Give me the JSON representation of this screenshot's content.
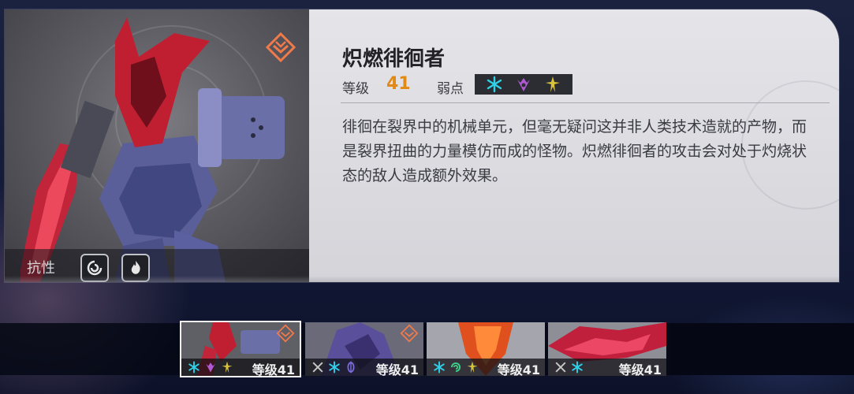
{
  "enemy": {
    "name": "炽燃徘徊者",
    "level_label": "等级",
    "level_value": "41",
    "weakness_label": "弱点",
    "weaknesses": [
      "ice-icon",
      "void-icon",
      "lightning-icon"
    ],
    "resistance_label": "抗性",
    "resistances": [
      "wind-resist-icon",
      "fire-resist-icon"
    ],
    "description": "徘徊在裂界中的机械单元，但毫无疑问这并非人类技术造就的产物，而是裂界扭曲的力量模仿而成的怪物。炽燃徘徊者的攻击会对处于灼烧状态的敌人造成额外效果。"
  },
  "colors": {
    "level_accent": "#e28a18",
    "ice": "#2fd0e8",
    "void": "#b25ad6",
    "lightning": "#d9c33a",
    "physical": "#c8c8c8",
    "imaginary": "#7a6de0",
    "wind": "#3fce8a"
  },
  "enemy_list": [
    {
      "label": "等级41",
      "weaknesses": [
        "ice-icon",
        "void-icon",
        "lightning-icon"
      ],
      "elite": true,
      "selected": true
    },
    {
      "label": "等级41",
      "weaknesses": [
        "physical-icon",
        "ice-icon",
        "imaginary-icon"
      ],
      "elite": true,
      "selected": false
    },
    {
      "label": "等级41",
      "weaknesses": [
        "ice-icon",
        "wind-icon",
        "lightning-icon"
      ],
      "elite": false,
      "selected": false
    },
    {
      "label": "等级41",
      "weaknesses": [
        "physical-icon",
        "ice-icon"
      ],
      "elite": false,
      "selected": false
    }
  ]
}
